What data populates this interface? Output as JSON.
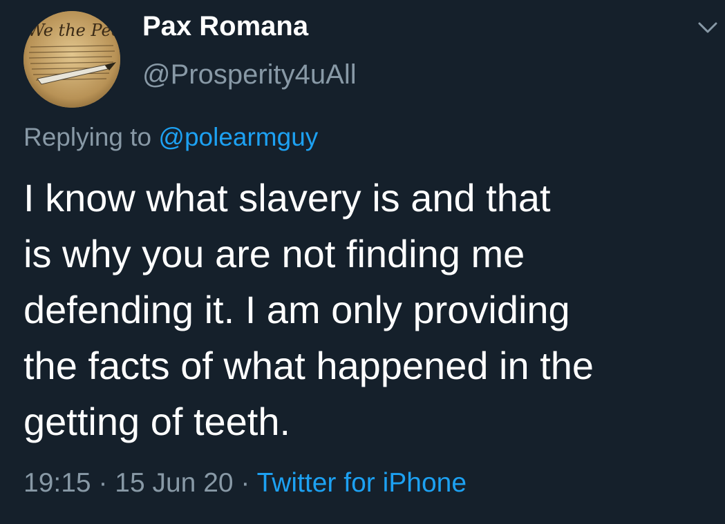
{
  "tweet": {
    "display_name": "Pax Romana",
    "handle": "@Prosperity4uAll",
    "reply_prefix": "Replying to ",
    "reply_mention": "@polearmguy",
    "text_lines": [
      "I know what slavery is and that",
      "is why you are not finding me",
      "defending it. I am only providing",
      "the facts of what happened in the",
      "getting of teeth."
    ],
    "time": "19:15",
    "separator": " · ",
    "date": "15 Jun 20",
    "source": "Twitter for iPhone",
    "avatar_text": "We the Peo"
  },
  "icons": {
    "menu": "chevron-down-icon"
  },
  "colors": {
    "background": "#15202b",
    "text": "#ffffff",
    "secondary": "#8899a6",
    "link": "#1da1f2"
  }
}
